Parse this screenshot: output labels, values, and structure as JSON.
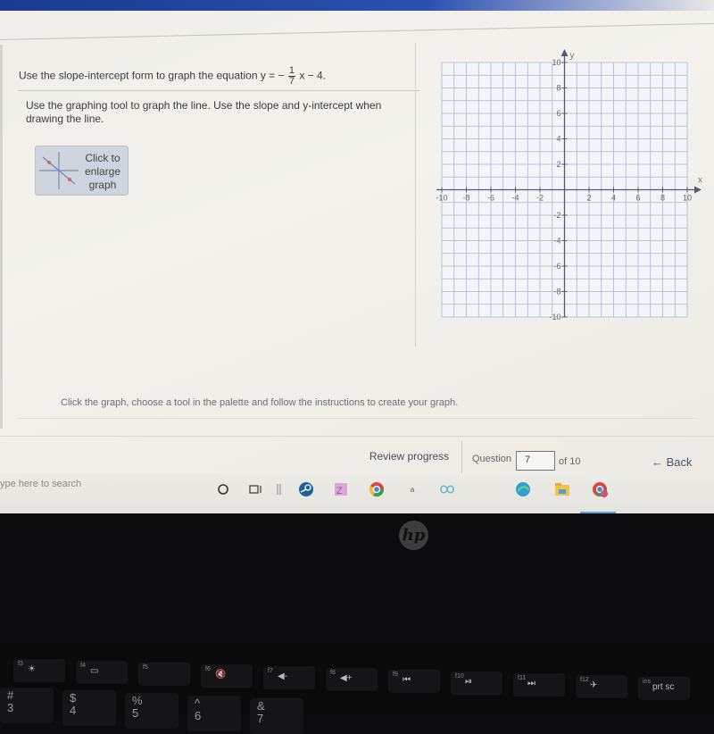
{
  "question": {
    "prefix": "Use the slope-intercept form to graph the equation y = −",
    "frac_num": "1",
    "frac_den": "7",
    "suffix": "x − 4."
  },
  "instructions": "Use the graphing tool to graph the line.  Use the slope and y-intercept when drawing the line.",
  "enlarge_button": {
    "line1": "Click to",
    "line2": "enlarge",
    "line3": "graph"
  },
  "graph": {
    "x_label": "x",
    "y_label": "y",
    "x_ticks": [
      "-10",
      "-8",
      "-6",
      "-4",
      "-2",
      "2",
      "4",
      "6",
      "8",
      "10"
    ],
    "y_ticks": [
      "10",
      "8",
      "6",
      "4",
      "2",
      "-2",
      "-4",
      "-6",
      "-8",
      "-10"
    ],
    "x_range": [
      -10,
      10
    ],
    "y_range": [
      -10,
      10
    ],
    "grid_color": "#a9b4d6",
    "axis_color": "#505a78"
  },
  "hint": "Click the graph, choose a tool in the palette and follow the instructions to create your graph.",
  "footer": {
    "review_label": "Review progress",
    "question_label": "Question",
    "question_value": "7",
    "of_label": "of 10",
    "back_label": "← Back"
  },
  "taskbar": {
    "search_placeholder": "ype here to search",
    "icons": [
      "cortana-icon",
      "task-view-icon",
      "divider",
      "steam-icon",
      "app-icon",
      "chrome-icon",
      "app-a-icon",
      "infinity-icon",
      "edge-icon",
      "file-explorer-icon",
      "chrome-icon"
    ]
  },
  "laptop": {
    "brand": "hp",
    "keys": [
      {
        "sub": "f3",
        "glyph": "☀"
      },
      {
        "sub": "f4",
        "glyph": "▭"
      },
      {
        "sub": "f5",
        "glyph": ""
      },
      {
        "sub": "f6",
        "glyph": "🔇"
      },
      {
        "sub": "f7",
        "glyph": "◀-"
      },
      {
        "sub": "f8",
        "glyph": "◀+"
      },
      {
        "sub": "f9",
        "glyph": "⏮"
      },
      {
        "sub": "f10",
        "glyph": "⏯"
      },
      {
        "sub": "f11",
        "glyph": "⏭"
      },
      {
        "sub": "f12",
        "glyph": "✈"
      },
      {
        "sub": "ins",
        "glyph": "prt sc"
      }
    ],
    "num_keys": [
      "#\n3",
      "$\n4",
      "%\n5",
      "^\n6",
      "&\n7"
    ]
  }
}
